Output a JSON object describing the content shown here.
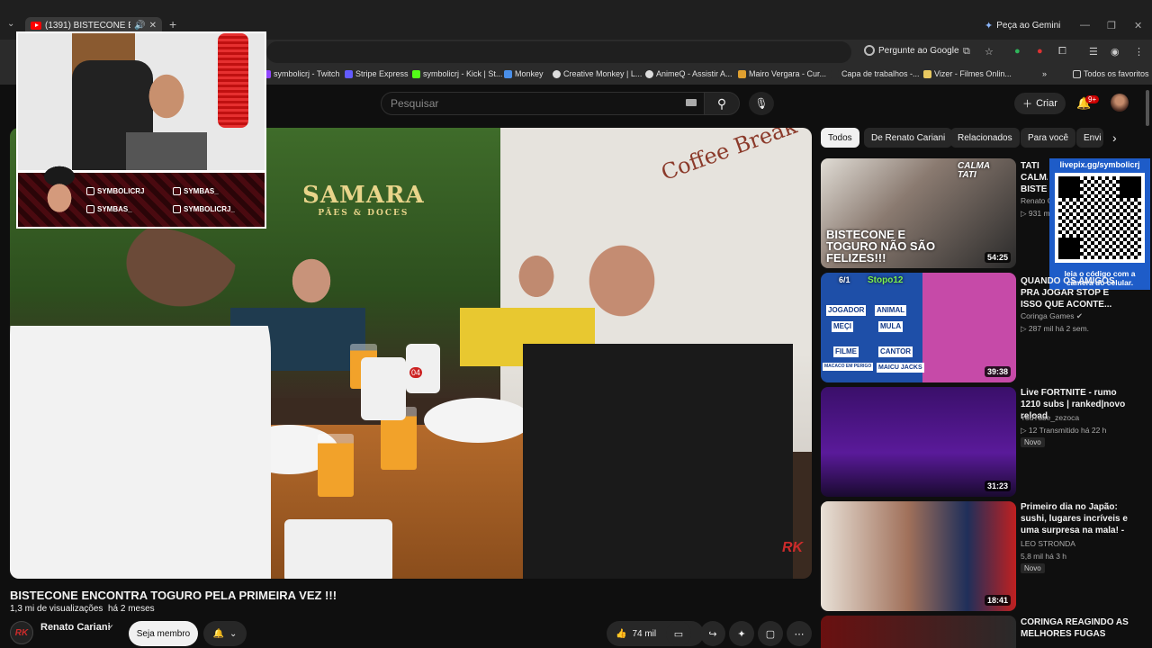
{
  "browser": {
    "tab_title": "(1391) BISTECONE ENCONT",
    "gemini_label": "Peça ao Gemini",
    "ask_google_label": "Pergunte ao Google",
    "bookmarks": [
      "symbolicrj - Twitch",
      "Stripe Express",
      "symbolicrj - Kick | St...",
      "Monkey",
      "Creative Monkey | L...",
      "AnimeQ - Assistir A...",
      "Mairo Vergara - Cur...",
      "Capa de trabalhos -...",
      "Vizer - Filmes Onlin..."
    ],
    "all_favorites": "Todos os favoritos"
  },
  "masthead": {
    "search_placeholder": "Pesquisar",
    "create_label": "Criar",
    "notification_count": "9+"
  },
  "video": {
    "title": "BISTECONE ENCONTRA TOGURO PELA PRIMEIRA VEZ !!!",
    "views": "1,3 mi de visualizações",
    "age": "há 2 meses",
    "channel": "Renato Cariani",
    "channel_avatar": "RK",
    "member_label": "Seja membro",
    "likes": "74 mil",
    "scene_sign": "SAMARA",
    "scene_sign_sub": "PÃES & DOCES",
    "scene_coffee": "Coffee Break",
    "scene_plate_number": "04",
    "watermark": "RK"
  },
  "overlay": {
    "socials": [
      "SYMBOLICRJ",
      "SYMBAS_",
      "SYMBAS_",
      "SYMBOLICRJ_"
    ],
    "qr_label": "livepix.gg/symbolicrj",
    "qr_caption": "leia o código com a câmera do celular."
  },
  "chips": [
    "Todos",
    "De Renato Cariani",
    "Relacionados",
    "Para você",
    "Envi"
  ],
  "recommendations": [
    {
      "title": "TATI CALMA BISTECONE CLIMA",
      "channel": "Renato C",
      "stats": "931 m",
      "duration": "54:25",
      "thumb_text": "BISTECONE E TOGURO NÃO SÃO FELIZES!!!",
      "thumb_corner": "CALMA TATI"
    },
    {
      "title": "QUANDO OS AMIGOS PRA JOGAR STOP E ISSO QUE ACONTE...",
      "channel": "Coringa Games",
      "stats": "287 mil   há 2 sem.",
      "duration": "39:38",
      "thumb_cells": [
        "JOGADOR",
        "ANIMAL",
        "MEÇI",
        "MULA",
        "FILME",
        "CANTOR",
        "MACACO EM PERIGO",
        "MAICU JACKS"
      ],
      "thumb_header": "Stopo12",
      "thumb_round": "6/1"
    },
    {
      "title": "Live FORTNITE -  rumo 1210 subs | ranked|novo reload",
      "channel": "YouTube_zezoca",
      "stats": "12   Transmitido há 22 h",
      "badge": "Novo",
      "duration": "31:23"
    },
    {
      "title": "Primeiro dia no Japão: sushi, lugares incríveis e uma surpresa na mala! - Leo ...",
      "channel": "LEO STRONDA",
      "stats": "5,8 mil   há 3 h",
      "badge": "Novo",
      "duration": "18:41"
    },
    {
      "title": "CORINGA REAGINDO AS MELHORES FUGAS"
    }
  ],
  "colors": {
    "bg": "#0f0f0f",
    "accent_red": "#ff0000",
    "livepix_blue": "#1e5cc8"
  }
}
